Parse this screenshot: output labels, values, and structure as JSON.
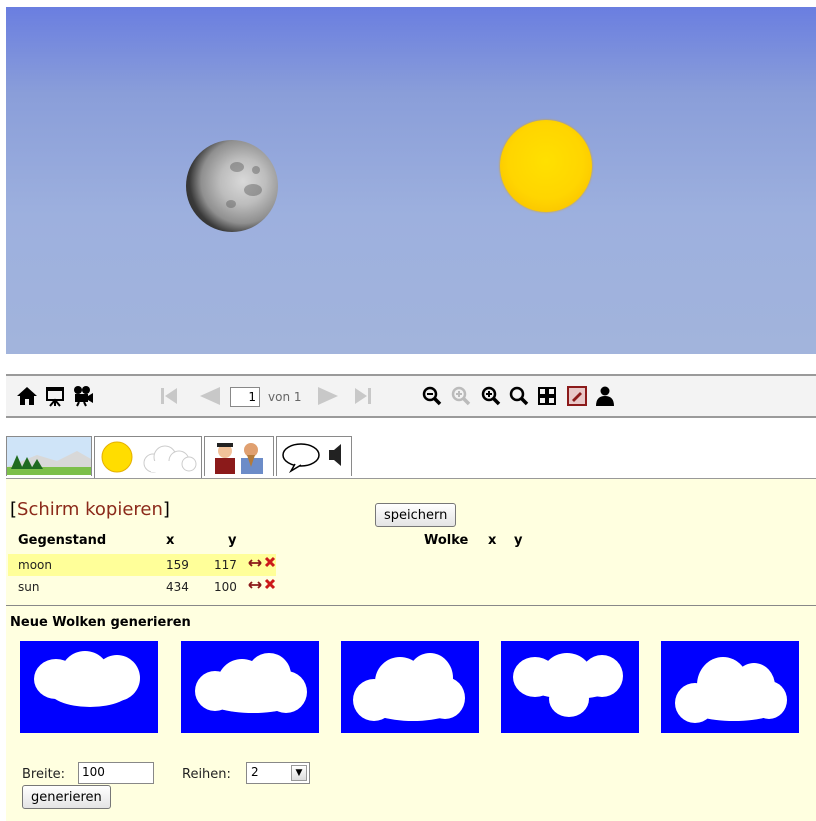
{
  "toolbar": {
    "page_current": "1",
    "page_of": "von 1",
    "icons": [
      "home-icon",
      "presentation-icon",
      "camera-icon",
      "first-page-icon",
      "prev-page-icon",
      "next-page-icon",
      "last-page-icon",
      "zoom-out-icon",
      "zoom-reset-icon",
      "zoom-in-icon",
      "zoom-fit-icon",
      "grid-view-icon",
      "edit-icon",
      "user-icon"
    ]
  },
  "tabs": [
    "landscape-tab",
    "sky-objects-tab",
    "characters-tab",
    "speech-sound-tab"
  ],
  "panel": {
    "copy_link": "Schirm kopieren",
    "save_label": "speichern",
    "objects_header": {
      "name": "Gegenstand",
      "x": "x",
      "y": "y"
    },
    "clouds_header": {
      "name": "Wolke",
      "x": "x",
      "y": "y"
    },
    "objects": [
      {
        "name": "moon",
        "x": "159",
        "y": "117"
      },
      {
        "name": "sun",
        "x": "434",
        "y": "100"
      }
    ],
    "generate_title": "Neue Wolken generieren",
    "width_label": "Breite:",
    "width_value": "100",
    "rows_label": "Reihen:",
    "rows_value": "2",
    "generate_label": "generieren"
  },
  "colors": {
    "sky_top": "#6a7ee0",
    "sky_bottom": "#a2b4dc",
    "sun": "#ffd500",
    "panel_bg": "#ffffe0",
    "link": "#8b2a1a",
    "cloud_bg": "#0000ff"
  }
}
